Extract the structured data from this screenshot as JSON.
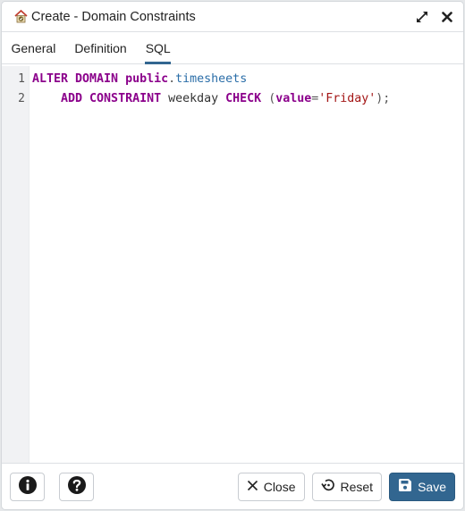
{
  "dialog": {
    "title": "Create - Domain Constraints",
    "icons": {
      "title": "domain-constraint-icon",
      "maximize": "expand-icon",
      "close": "close-icon"
    }
  },
  "tabs": [
    {
      "label": "General",
      "active": false
    },
    {
      "label": "Definition",
      "active": false
    },
    {
      "label": "SQL",
      "active": true
    }
  ],
  "editor": {
    "line_numbers": [
      "1",
      "2"
    ],
    "lines": [
      {
        "tokens": [
          {
            "text": "ALTER DOMAIN ",
            "type": "kw"
          },
          {
            "text": "public",
            "type": "kw"
          },
          {
            "text": ".",
            "type": "punc"
          },
          {
            "text": "timesheets",
            "type": "var"
          }
        ]
      },
      {
        "tokens": [
          {
            "text": "    ADD CONSTRAINT ",
            "type": "kw"
          },
          {
            "text": "weekday ",
            "type": "plain"
          },
          {
            "text": "CHECK",
            "type": "kw"
          },
          {
            "text": " (",
            "type": "punc"
          },
          {
            "text": "value",
            "type": "kw"
          },
          {
            "text": "=",
            "type": "punc"
          },
          {
            "text": "'Friday'",
            "type": "str"
          },
          {
            "text": ");",
            "type": "punc"
          }
        ]
      }
    ]
  },
  "footer": {
    "info_icon": "info-icon",
    "help_icon": "help-icon",
    "close_label": "Close",
    "reset_label": "Reset",
    "save_label": "Save"
  },
  "colors": {
    "primary": "#326690",
    "keyword": "#8b008b",
    "identifier": "#2b6ea8",
    "string": "#a31515"
  }
}
